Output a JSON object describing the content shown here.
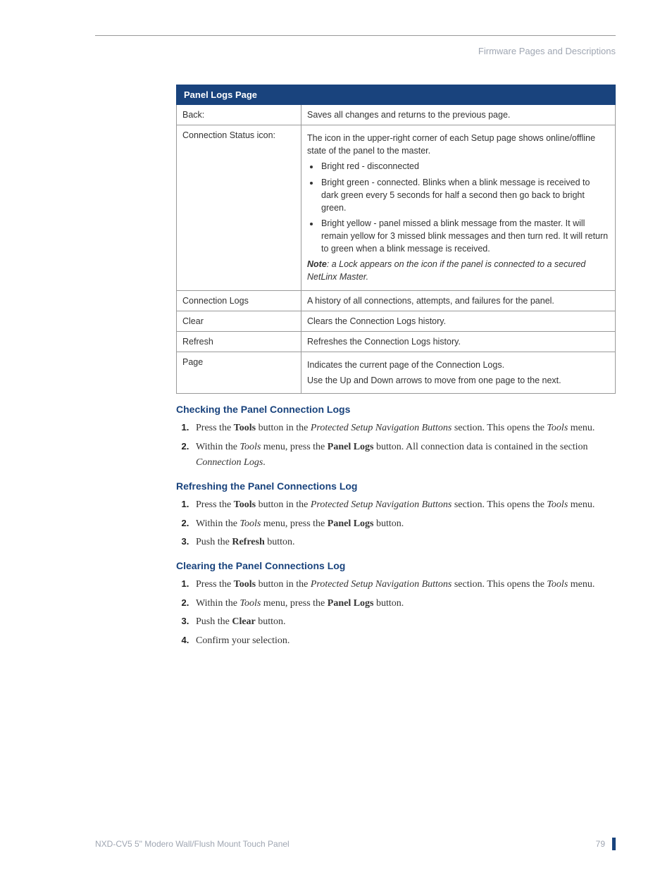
{
  "header": {
    "breadcrumb": "Firmware Pages and Descriptions"
  },
  "table": {
    "title": "Panel Logs Page",
    "rows": [
      {
        "label": "Back:",
        "plain": "Saves all changes and returns to the previous page."
      },
      {
        "label": "Connection Status icon:",
        "intro": "The icon in the upper-right corner of each Setup page shows online/offline state of the panel to the master.",
        "bullets": [
          "Bright red - disconnected",
          "Bright green - connected. Blinks when a blink message is received to dark green every 5 seconds for half a second then go back to bright green.",
          "Bright yellow - panel missed a blink message from the master. It will remain yellow for 3 missed blink messages and then turn red. It will return to green when a blink message is received."
        ],
        "note_label": "Note",
        "note": ": a Lock appears on the icon if the panel is connected to a secured NetLinx Master."
      },
      {
        "label": "Connection Logs",
        "plain": "A history of all connections, attempts, and failures for the panel."
      },
      {
        "label": "Clear",
        "plain": "Clears the Connection Logs history."
      },
      {
        "label": "Refresh",
        "plain": "Refreshes the Connection Logs history."
      },
      {
        "label": "Page",
        "multi": [
          "Indicates the current page of the Connection Logs.",
          "Use the Up and Down arrows to move from one page to the next."
        ]
      }
    ]
  },
  "sections": {
    "checking": {
      "title": "Checking the Panel Connection Logs",
      "steps": [
        {
          "parts": [
            {
              "t": "Press the "
            },
            {
              "t": "Tools",
              "b": true
            },
            {
              "t": " button in the "
            },
            {
              "t": "Protected Setup Navigation Buttons",
              "i": true
            },
            {
              "t": " section. This opens the "
            },
            {
              "t": "Tools",
              "i": true
            },
            {
              "t": " menu."
            }
          ]
        },
        {
          "parts": [
            {
              "t": "Within the "
            },
            {
              "t": "Tools",
              "i": true
            },
            {
              "t": " menu, press the "
            },
            {
              "t": "Panel Logs",
              "b": true
            },
            {
              "t": " button. All connection data is contained in the section "
            },
            {
              "t": "Connection Logs",
              "i": true
            },
            {
              "t": "."
            }
          ]
        }
      ]
    },
    "refreshing": {
      "title": "Refreshing the Panel Connections Log",
      "steps": [
        {
          "parts": [
            {
              "t": "Press the "
            },
            {
              "t": "Tools",
              "b": true
            },
            {
              "t": " button in the "
            },
            {
              "t": "Protected Setup Navigation Buttons",
              "i": true
            },
            {
              "t": " section. This opens the "
            },
            {
              "t": "Tools",
              "i": true
            },
            {
              "t": " menu."
            }
          ]
        },
        {
          "parts": [
            {
              "t": "Within the "
            },
            {
              "t": "Tools",
              "i": true
            },
            {
              "t": " menu, press the "
            },
            {
              "t": "Panel Logs",
              "b": true
            },
            {
              "t": " button."
            }
          ]
        },
        {
          "parts": [
            {
              "t": "Push the "
            },
            {
              "t": "Refresh",
              "b": true
            },
            {
              "t": " button."
            }
          ]
        }
      ]
    },
    "clearing": {
      "title": "Clearing the Panel Connections Log",
      "steps": [
        {
          "parts": [
            {
              "t": "Press the "
            },
            {
              "t": "Tools",
              "b": true
            },
            {
              "t": " button in the "
            },
            {
              "t": "Protected Setup Navigation Buttons",
              "i": true
            },
            {
              "t": " section. This opens the "
            },
            {
              "t": "Tools",
              "i": true
            },
            {
              "t": " menu."
            }
          ]
        },
        {
          "parts": [
            {
              "t": "Within the "
            },
            {
              "t": "Tools",
              "i": true
            },
            {
              "t": " menu, press the "
            },
            {
              "t": "Panel Logs",
              "b": true
            },
            {
              "t": " button."
            }
          ]
        },
        {
          "parts": [
            {
              "t": "Push the "
            },
            {
              "t": "Clear",
              "b": true
            },
            {
              "t": " button."
            }
          ]
        },
        {
          "parts": [
            {
              "t": "Confirm your selection."
            }
          ]
        }
      ]
    }
  },
  "footer": {
    "product": "NXD-CV5 5\" Modero Wall/Flush Mount Touch Panel",
    "page": "79"
  }
}
